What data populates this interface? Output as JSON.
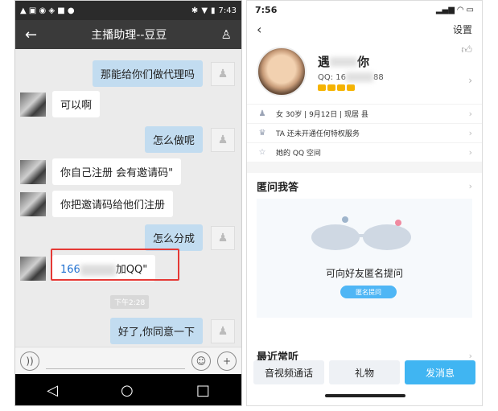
{
  "left": {
    "status_time": "7:43",
    "title": "主播助理--豆豆",
    "messages": [
      {
        "side": "me",
        "text": "那能给你们做代理吗"
      },
      {
        "side": "other",
        "text": "可以啊"
      },
      {
        "side": "me",
        "text": "怎么做呢"
      },
      {
        "side": "other",
        "text": "你自己注册 会有邀请码\""
      },
      {
        "side": "other",
        "text": "你把邀请码给他们注册"
      },
      {
        "side": "me",
        "text": "怎么分成"
      },
      {
        "side": "other",
        "text_prefix": "166",
        "text_suffix": "加QQ\""
      },
      {
        "side": "me",
        "text": "好了,你同意一下"
      }
    ],
    "timestamp": "下午2:28",
    "colors": {
      "highlight": "#e53935",
      "bubble_me": "#c2dcf0",
      "link": "#1e6fd0"
    }
  },
  "right": {
    "status_time": "7:56",
    "settings": "设置",
    "name_prefix": "遇",
    "name_suffix": "你",
    "qq_prefix": "QQ: 16",
    "qq_suffix": "88",
    "info": [
      {
        "icon": "person-icon",
        "text": "女 30岁 | 9月12日 | 现居 县"
      },
      {
        "icon": "crown-icon",
        "text": "TA 还未开通任何特权服务"
      },
      {
        "icon": "star-icon",
        "text": "她的 QQ 空间"
      }
    ],
    "section_anon": "匿问我答",
    "anon_text": "可向好友匿名提问",
    "anon_button": "匿名提问",
    "section_listen": "最近常听",
    "buttons": {
      "video": "音视频通话",
      "gift": "礼物",
      "message": "发消息"
    },
    "colors": {
      "primary": "#40b5f2"
    }
  }
}
